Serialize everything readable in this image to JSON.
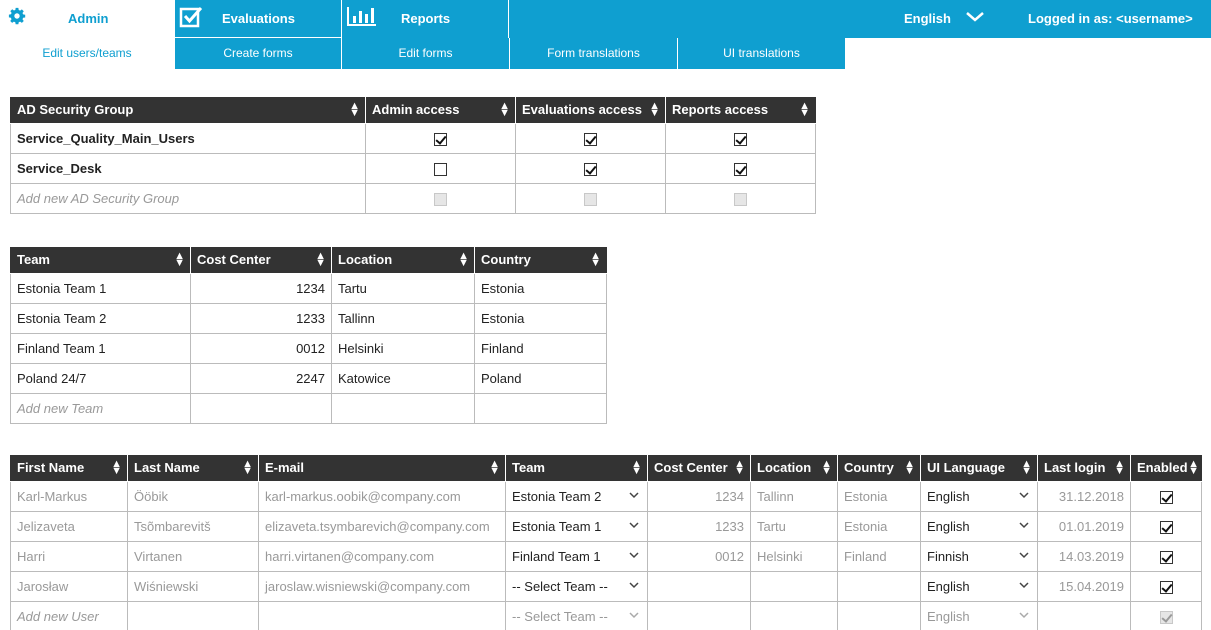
{
  "nav": {
    "admin_label": "Admin",
    "evaluations_label": "Evaluations",
    "reports_label": "Reports",
    "language": "English",
    "login_text": "Logged in as: <username>",
    "accent_color": "#0f9fd0",
    "sub_tabs": [
      "Edit users/teams",
      "Create forms",
      "Edit forms",
      "Form translations",
      "UI translations"
    ]
  },
  "groups_table": {
    "headers": [
      "AD Security Group",
      "Admin access",
      "Evaluations access",
      "Reports access"
    ],
    "rows": [
      {
        "name": "Service_Quality_Main_Users",
        "admin": true,
        "evaluations": true,
        "reports": true
      },
      {
        "name": "Service_Desk",
        "admin": false,
        "evaluations": true,
        "reports": true
      }
    ],
    "add_placeholder": "Add new AD Security Group"
  },
  "teams_table": {
    "headers": [
      "Team",
      "Cost Center",
      "Location",
      "Country"
    ],
    "rows": [
      {
        "team": "Estonia Team 1",
        "cost_center": "1234",
        "location": "Tartu",
        "country": "Estonia"
      },
      {
        "team": "Estonia Team 2",
        "cost_center": "1233",
        "location": "Tallinn",
        "country": "Estonia"
      },
      {
        "team": "Finland Team 1",
        "cost_center": "0012",
        "location": "Helsinki",
        "country": "Finland"
      },
      {
        "team": "Poland 24/7",
        "cost_center": "2247",
        "location": "Katowice",
        "country": "Poland"
      }
    ],
    "add_placeholder": "Add new Team"
  },
  "users_table": {
    "headers": [
      "First Name",
      "Last Name",
      "E-mail",
      "Team",
      "Cost Center",
      "Location",
      "Country",
      "UI Language",
      "Last login",
      "Enabled"
    ],
    "rows": [
      {
        "first": "Karl-Markus",
        "last": "Ööbik",
        "email": "karl-markus.oobik@company.com",
        "team": "Estonia Team 2",
        "cost_center": "1234",
        "location": "Tallinn",
        "country": "Estonia",
        "ui_language": "English",
        "last_login": "31.12.2018",
        "enabled": true
      },
      {
        "first": "Jelizaveta",
        "last": "Tsõmbarevitš",
        "email": "elizaveta.tsymbarevich@company.com",
        "team": "Estonia Team 1",
        "cost_center": "1233",
        "location": "Tartu",
        "country": "Estonia",
        "ui_language": "English",
        "last_login": "01.01.2019",
        "enabled": true
      },
      {
        "first": "Harri",
        "last": "Virtanen",
        "email": "harri.virtanen@company.com",
        "team": "Finland Team 1",
        "cost_center": "0012",
        "location": "Helsinki",
        "country": "Finland",
        "ui_language": "Finnish",
        "last_login": "14.03.2019",
        "enabled": true
      },
      {
        "first": "Jarosław",
        "last": "Wiśniewski",
        "email": "jaroslaw.wisniewski@company.com",
        "team": "-- Select Team --",
        "cost_center": "",
        "location": "",
        "country": "",
        "ui_language": "English",
        "last_login": "15.04.2019",
        "enabled": true
      }
    ],
    "add_placeholder": "Add new User",
    "add_team_default": "-- Select Team --",
    "add_language_default": "English"
  }
}
